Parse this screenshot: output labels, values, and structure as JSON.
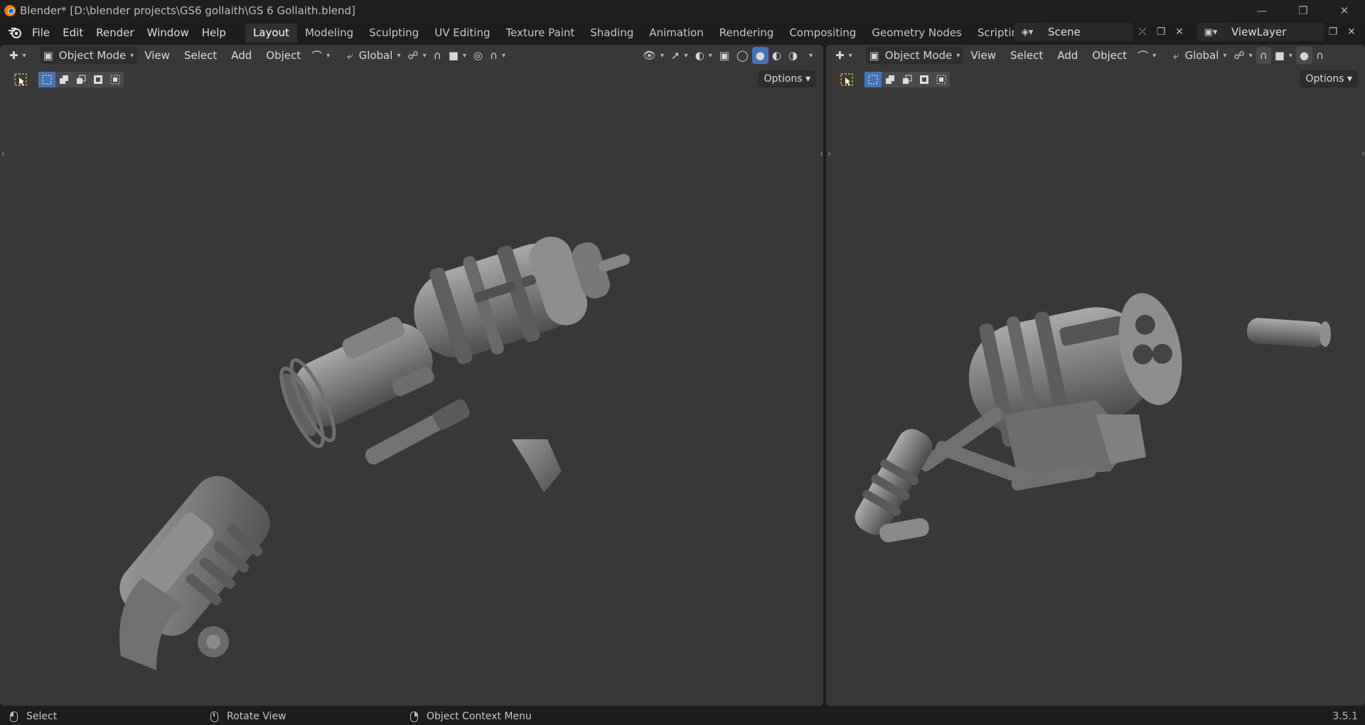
{
  "window": {
    "title": "Blender* [D:\\blender projects\\GS6 gollaith\\GS 6 Gollaith.blend]",
    "min_icon": "minimize-icon",
    "max_icon": "restore-icon",
    "close_icon": "close-icon"
  },
  "menubar": {
    "items": [
      "File",
      "Edit",
      "Render",
      "Window",
      "Help"
    ]
  },
  "workspaces": {
    "tabs": [
      "Layout",
      "Modeling",
      "Sculpting",
      "UV Editing",
      "Texture Paint",
      "Shading",
      "Animation",
      "Rendering",
      "Compositing",
      "Geometry Nodes",
      "Scripting"
    ],
    "active": "Layout",
    "add_label": "+"
  },
  "scene": {
    "name": "Scene",
    "view_layer": "ViewLayer"
  },
  "viewport_left": {
    "mode": "Object Mode",
    "menus": [
      "View",
      "Select",
      "Add",
      "Object"
    ],
    "orientation": "Global",
    "options_label": "Options"
  },
  "viewport_right": {
    "mode": "Object Mode",
    "menus": [
      "View",
      "Select",
      "Add",
      "Object"
    ],
    "orientation": "Global",
    "options_label": "Options"
  },
  "statusbar": {
    "select": "Select",
    "rotate": "Rotate View",
    "context": "Object Context Menu",
    "version": "3.5.1"
  },
  "colors": {
    "viewport_bg": "#383838",
    "accent": "#4772b3",
    "model": "#8a8a8a"
  }
}
